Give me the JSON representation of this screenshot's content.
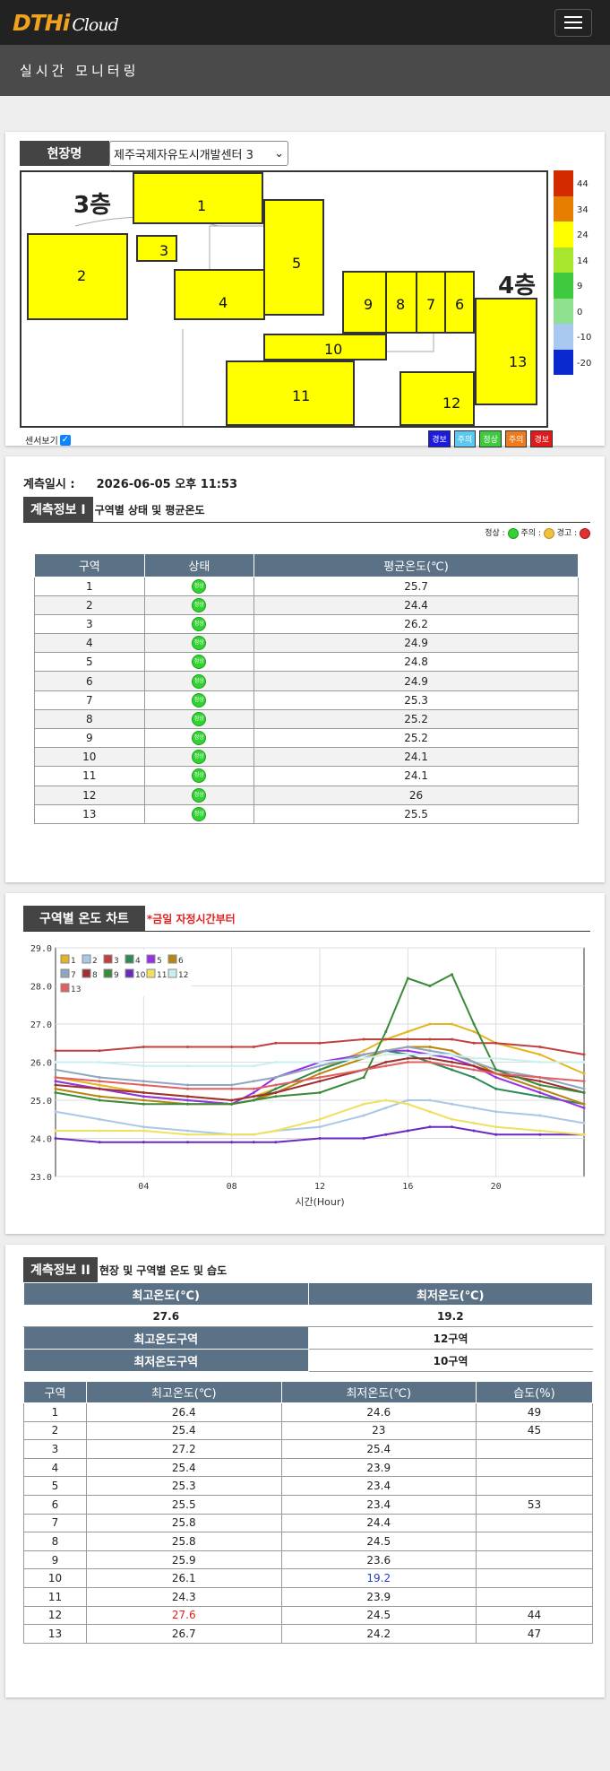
{
  "header": {
    "logo_main": "DTHi",
    "logo_sub": "Cloud",
    "page_title": "실시간 모니터링"
  },
  "site": {
    "label": "현장명",
    "selected": "제주국제자유도시개발센터 3"
  },
  "floorplan": {
    "floor_labels": [
      "3층",
      "4층"
    ],
    "zones": [
      "1",
      "2",
      "3",
      "4",
      "5",
      "6",
      "7",
      "8",
      "9",
      "10",
      "11",
      "12",
      "13"
    ],
    "colorbar": [
      {
        "label": "44",
        "color": "#d42a00"
      },
      {
        "label": "34",
        "color": "#e67e00"
      },
      {
        "label": "24",
        "color": "#ffff00"
      },
      {
        "label": "14",
        "color": "#a8e62e"
      },
      {
        "label": "9",
        "color": "#3ec93e"
      },
      {
        "label": "0",
        "color": "#8ee08e"
      },
      {
        "label": "-10",
        "color": "#a8c8f0"
      },
      {
        "label": "-20",
        "color": "#0a2ad0"
      }
    ],
    "sensor_toggle_label": "센서보기",
    "badges": [
      {
        "label": "경보",
        "color": "#1a1ae0"
      },
      {
        "label": "주의",
        "color": "#5ac8f0"
      },
      {
        "label": "정상",
        "color": "#3ec93e"
      },
      {
        "label": "주의",
        "color": "#f07a1a"
      },
      {
        "label": "경보",
        "color": "#e01a1a"
      }
    ]
  },
  "measure": {
    "time_label": "계측일시 :",
    "time_value": "2026-06-05 오후 11:53",
    "info1_label": "계측정보 I",
    "info1_sub": "구역별 상태 및 평균온도",
    "legend_text": [
      "정상 :",
      "주의 :",
      "경고 :"
    ],
    "table_headers": [
      "구역",
      "상태",
      "평균온도(℃)"
    ],
    "rows": [
      {
        "zone": "1",
        "avg": "25.7"
      },
      {
        "zone": "2",
        "avg": "24.4"
      },
      {
        "zone": "3",
        "avg": "26.2"
      },
      {
        "zone": "4",
        "avg": "24.9"
      },
      {
        "zone": "5",
        "avg": "24.8"
      },
      {
        "zone": "6",
        "avg": "24.9"
      },
      {
        "zone": "7",
        "avg": "25.3"
      },
      {
        "zone": "8",
        "avg": "25.2"
      },
      {
        "zone": "9",
        "avg": "25.2"
      },
      {
        "zone": "10",
        "avg": "24.1"
      },
      {
        "zone": "11",
        "avg": "24.1"
      },
      {
        "zone": "12",
        "avg": "26"
      },
      {
        "zone": "13",
        "avg": "25.5"
      }
    ],
    "status_icon_text": "정상"
  },
  "chart_section": {
    "label": "구역별 온도 차트",
    "note": "*금일 자정시간부터"
  },
  "chart_data": {
    "type": "line",
    "xlabel": "시간(Hour)",
    "ylabel": "",
    "xlim": [
      0,
      24
    ],
    "ylim": [
      23.0,
      29.0
    ],
    "x_ticks": [
      "04",
      "08",
      "12",
      "16",
      "20"
    ],
    "y_ticks": [
      "29.0",
      "28.0",
      "27.0",
      "26.0",
      "25.0",
      "24.0",
      "23.0"
    ],
    "x": [
      0,
      2,
      4,
      6,
      8,
      9,
      10,
      12,
      14,
      15,
      16,
      17,
      18,
      19,
      20,
      22,
      24
    ],
    "series": [
      {
        "name": "1",
        "color": "#e6b422",
        "values": [
          25.6,
          25.4,
          25.2,
          25.1,
          25.0,
          25.1,
          25.3,
          25.8,
          26.3,
          26.6,
          26.8,
          27.0,
          27.0,
          26.8,
          26.5,
          26.2,
          25.7
        ]
      },
      {
        "name": "2",
        "color": "#aac8e6",
        "values": [
          24.7,
          24.5,
          24.3,
          24.2,
          24.1,
          24.1,
          24.2,
          24.3,
          24.6,
          24.8,
          25.0,
          25.0,
          24.9,
          24.8,
          24.7,
          24.6,
          24.4
        ]
      },
      {
        "name": "3",
        "color": "#c04040",
        "values": [
          26.3,
          26.3,
          26.4,
          26.4,
          26.4,
          26.4,
          26.5,
          26.5,
          26.6,
          26.6,
          26.6,
          26.6,
          26.6,
          26.5,
          26.5,
          26.4,
          26.2
        ]
      },
      {
        "name": "4",
        "color": "#2e8b57",
        "values": [
          25.5,
          25.3,
          25.1,
          25.0,
          24.9,
          25.0,
          25.3,
          25.8,
          26.2,
          26.3,
          26.2,
          26.0,
          25.8,
          25.6,
          25.3,
          25.1,
          24.9
        ]
      },
      {
        "name": "5",
        "color": "#9932e6",
        "values": [
          25.5,
          25.3,
          25.1,
          25.0,
          24.9,
          25.2,
          25.6,
          26.0,
          26.2,
          26.3,
          26.3,
          26.2,
          26.1,
          25.9,
          25.6,
          25.2,
          24.8
        ]
      },
      {
        "name": "6",
        "color": "#b8860b",
        "values": [
          25.3,
          25.1,
          25.0,
          24.9,
          24.9,
          25.0,
          25.2,
          25.7,
          26.1,
          26.3,
          26.4,
          26.4,
          26.3,
          26.0,
          25.7,
          25.3,
          24.9
        ]
      },
      {
        "name": "7",
        "color": "#8fa6c0",
        "values": [
          25.8,
          25.6,
          25.5,
          25.4,
          25.4,
          25.5,
          25.6,
          25.9,
          26.2,
          26.3,
          26.4,
          26.3,
          26.2,
          26.0,
          25.8,
          25.6,
          25.3
        ]
      },
      {
        "name": "8",
        "color": "#a03030",
        "values": [
          25.4,
          25.3,
          25.2,
          25.1,
          25.0,
          25.1,
          25.2,
          25.5,
          25.8,
          26.0,
          26.1,
          26.1,
          26.0,
          25.9,
          25.7,
          25.5,
          25.2
        ]
      },
      {
        "name": "9",
        "color": "#3a8a3a",
        "values": [
          25.2,
          25.0,
          24.9,
          24.9,
          24.9,
          25.0,
          25.1,
          25.2,
          25.6,
          26.8,
          28.2,
          28.0,
          28.3,
          27.0,
          25.8,
          25.4,
          25.2
        ]
      },
      {
        "name": "10",
        "color": "#6a2ac0",
        "values": [
          24.0,
          23.9,
          23.9,
          23.9,
          23.9,
          23.9,
          23.9,
          24.0,
          24.0,
          24.1,
          24.2,
          24.3,
          24.3,
          24.2,
          24.1,
          24.1,
          24.1
        ]
      },
      {
        "name": "11",
        "color": "#f0e060",
        "values": [
          24.2,
          24.2,
          24.2,
          24.1,
          24.1,
          24.1,
          24.2,
          24.5,
          24.9,
          25.0,
          24.9,
          24.7,
          24.5,
          24.4,
          24.3,
          24.2,
          24.1
        ]
      },
      {
        "name": "12",
        "color": "#c8f0f0",
        "values": [
          26.0,
          26.0,
          25.9,
          25.9,
          25.9,
          25.9,
          26.0,
          26.0,
          26.1,
          26.2,
          26.2,
          26.2,
          26.2,
          26.1,
          26.1,
          26.0,
          26.0
        ]
      },
      {
        "name": "13",
        "color": "#e06060",
        "values": [
          25.6,
          25.5,
          25.4,
          25.3,
          25.3,
          25.3,
          25.4,
          25.6,
          25.8,
          25.9,
          26.0,
          26.0,
          25.9,
          25.8,
          25.7,
          25.6,
          25.5
        ]
      }
    ],
    "grid": true,
    "legend": "top-left"
  },
  "info2": {
    "label": "계측정보 II",
    "sub": "현장 및 구역별 온도 및 습도",
    "max_label": "최고온도(℃)",
    "min_label": "최저온도(℃)",
    "max_value": "27.6",
    "min_value": "19.2",
    "max_zone_label": "최고온도구역",
    "max_zone_value": "12구역",
    "min_zone_label": "최저온도구역",
    "min_zone_value": "10구역",
    "table_headers": [
      "구역",
      "최고온도(℃)",
      "최저온도(℃)",
      "습도(%)"
    ],
    "rows": [
      {
        "zone": "1",
        "max": "26.4",
        "min": "24.6",
        "hum": "49"
      },
      {
        "zone": "2",
        "max": "25.4",
        "min": "23",
        "hum": "45"
      },
      {
        "zone": "3",
        "max": "27.2",
        "min": "25.4",
        "hum": ""
      },
      {
        "zone": "4",
        "max": "25.4",
        "min": "23.9",
        "hum": ""
      },
      {
        "zone": "5",
        "max": "25.3",
        "min": "23.4",
        "hum": ""
      },
      {
        "zone": "6",
        "max": "25.5",
        "min": "23.4",
        "hum": "53"
      },
      {
        "zone": "7",
        "max": "25.8",
        "min": "24.4",
        "hum": ""
      },
      {
        "zone": "8",
        "max": "25.8",
        "min": "24.5",
        "hum": ""
      },
      {
        "zone": "9",
        "max": "25.9",
        "min": "23.6",
        "hum": ""
      },
      {
        "zone": "10",
        "max": "26.1",
        "min": "19.2",
        "hum": ""
      },
      {
        "zone": "11",
        "max": "24.3",
        "min": "23.9",
        "hum": ""
      },
      {
        "zone": "12",
        "max": "27.6",
        "min": "24.5",
        "hum": "44"
      },
      {
        "zone": "13",
        "max": "26.7",
        "min": "24.2",
        "hum": "47"
      }
    ]
  }
}
